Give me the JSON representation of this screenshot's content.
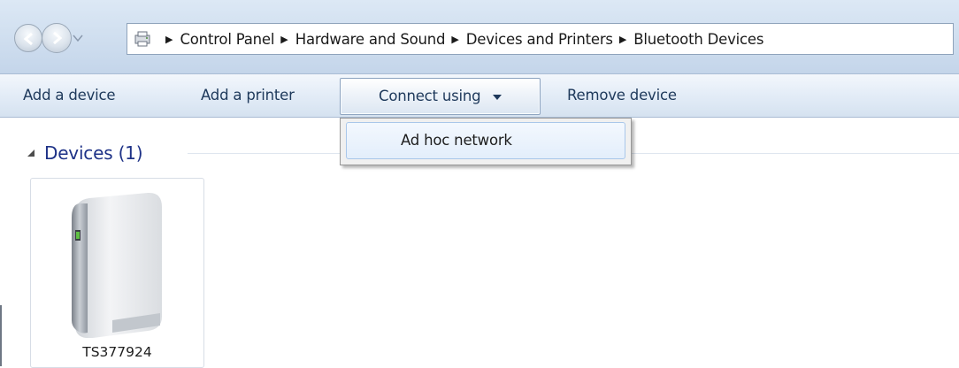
{
  "address_bar": {
    "breadcrumbs": [
      "Control Panel",
      "Hardware and Sound",
      "Devices and Printers",
      "Bluetooth Devices"
    ]
  },
  "command_bar": {
    "add_device": "Add a device",
    "add_printer": "Add a printer",
    "connect_using": "Connect using",
    "remove_device": "Remove device"
  },
  "connect_menu": {
    "items": [
      "Ad hoc network"
    ]
  },
  "content": {
    "group_label": "Devices (1)",
    "devices": [
      {
        "name": "TS377924",
        "icon": "router-icon"
      }
    ]
  },
  "colors": {
    "group_label": "#1e3287",
    "command_text": "#1e395b",
    "menu_highlight": "#e3eefb"
  }
}
